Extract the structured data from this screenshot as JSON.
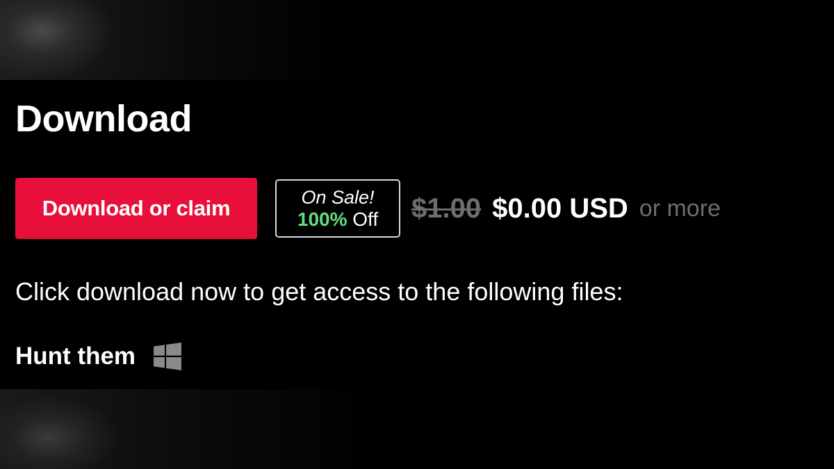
{
  "section": {
    "title": "Download"
  },
  "purchase": {
    "download_button_label": "Download or claim",
    "sale_badge": {
      "line1": "On Sale!",
      "percent": "100%",
      "off_label": "Off"
    },
    "original_price": "$1.00",
    "current_price": "$0.00 USD",
    "or_more_label": "or more",
    "button_color": "#e8103a",
    "sale_percent_color": "#5ee07e"
  },
  "instructions": "Click download now to get access to the following files:",
  "files": [
    {
      "name": "Hunt them",
      "platform_icon": "windows-icon"
    }
  ]
}
